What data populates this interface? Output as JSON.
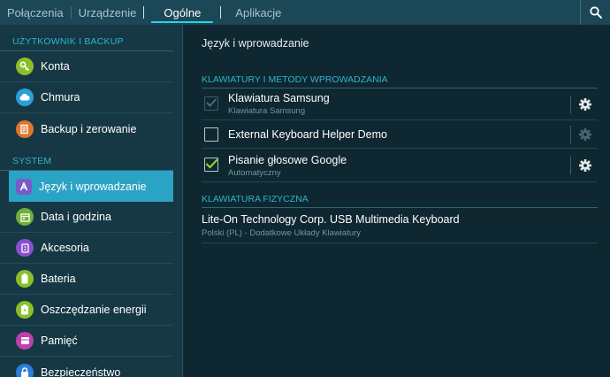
{
  "tabs": [
    {
      "label": "Połączenia"
    },
    {
      "label": "Urządzenie"
    },
    {
      "label": "Ogólne",
      "active": true
    },
    {
      "label": "Aplikacje"
    }
  ],
  "sidebar": {
    "section_user": "UŻYTKOWNIK I BACKUP",
    "section_system": "SYSTEM",
    "user_items": [
      {
        "label": "Konta",
        "icon": "key-icon",
        "color": "#8bbf2a"
      },
      {
        "label": "Chmura",
        "icon": "cloud-icon",
        "color": "#2a9fd8"
      },
      {
        "label": "Backup i zerowanie",
        "icon": "backup-icon",
        "color": "#e0762a"
      }
    ],
    "system_items": [
      {
        "label": "Język i wprowadzanie",
        "icon": "language-icon",
        "color": "#7a5ac8",
        "active": true
      },
      {
        "label": "Data i godzina",
        "icon": "calendar-icon",
        "color": "#6db03a"
      },
      {
        "label": "Akcesoria",
        "icon": "accessories-icon",
        "color": "#8a4fd0"
      },
      {
        "label": "Bateria",
        "icon": "battery-icon",
        "color": "#8bbf2a"
      },
      {
        "label": "Oszczędzanie energii",
        "icon": "power-saving-icon",
        "color": "#8bbf2a"
      },
      {
        "label": "Pamięć",
        "icon": "storage-icon",
        "color": "#c03fb0"
      },
      {
        "label": "Bezpieczeństwo",
        "icon": "lock-icon",
        "color": "#2a7fd8"
      }
    ]
  },
  "main": {
    "title": "Język i wprowadzanie",
    "keyboards_header": "KLAWIATURY I METODY WPROWADZANIA",
    "keyboards": [
      {
        "title": "Klawiatura Samsung",
        "subtitle": "Klawiatura Samsung",
        "checked": true,
        "disabled": true,
        "gear_enabled": true
      },
      {
        "title": "External Keyboard Helper Demo",
        "subtitle": "",
        "checked": false,
        "disabled": false,
        "gear_enabled": false
      },
      {
        "title": "Pisanie głosowe Google",
        "subtitle": "Automatyczny",
        "checked": true,
        "disabled": false,
        "gear_enabled": true
      }
    ],
    "physical_header": "KLAWIATURA FIZYCZNA",
    "physical_keyboard": {
      "title": "Lite-On Technology Corp. USB Multimedia Keyboard",
      "subtitle": "Polski (PL) - Dodatkowe Układy Klawiatury"
    }
  },
  "colors": {
    "accent": "#2aa3c4",
    "check": "#8ad32a",
    "header_text": "#2bb6cf"
  }
}
